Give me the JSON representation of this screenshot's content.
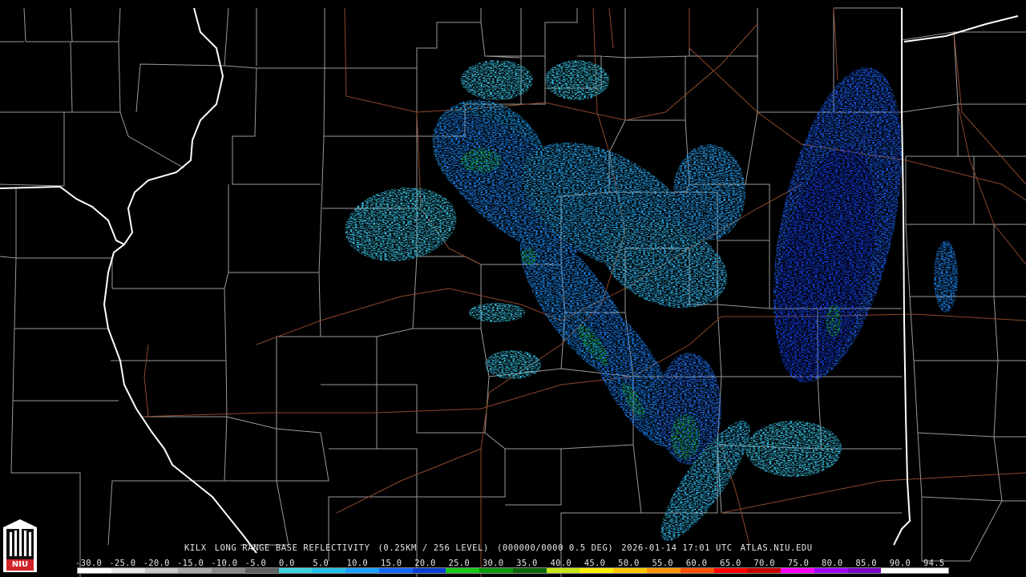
{
  "caption": {
    "station": "KILX",
    "product": "LONG RANGE BASE REFLECTIVITY",
    "resolution": "(0.25KM / 256 LEVEL)",
    "volume": "(000000/0000 0.5 DEG)",
    "datetime": "2026-01-14 17:01 UTC",
    "site": "ATLAS.NIU.EDU"
  },
  "logo": {
    "text": "NIU",
    "icon": "niu-tower-icon"
  },
  "colors": {
    "background": "#000000",
    "county_line": "#9a9a9a",
    "state_line": "#ffffff",
    "road": "#8b4a2a"
  },
  "scale": {
    "labels": [
      "-30.0",
      "-25.0",
      "-20.0",
      "-15.0",
      "-10.0",
      "-5.0",
      "0.0",
      "5.0",
      "10.0",
      "15.0",
      "20.0",
      "25.0",
      "30.0",
      "35.0",
      "40.0",
      "45.0",
      "50.0",
      "55.0",
      "60.0",
      "65.0",
      "70.0",
      "75.0",
      "80.0",
      "85.0",
      "90.0",
      "94.5"
    ],
    "colors": [
      "#ffffff",
      "#e8e8e8",
      "#c8c8c8",
      "#a8a8a8",
      "#888888",
      "#606060",
      "#3ad4e0",
      "#22c0e8",
      "#1aa0ff",
      "#1464ff",
      "#0a3cd2",
      "#14c814",
      "#0a960a",
      "#0a640a",
      "#c8e614",
      "#fff000",
      "#ffc800",
      "#ff9600",
      "#ff5000",
      "#ff0000",
      "#c80000",
      "#ff00ff",
      "#a000ff",
      "#7800c8",
      "#ffffff",
      "#ffffff"
    ]
  }
}
